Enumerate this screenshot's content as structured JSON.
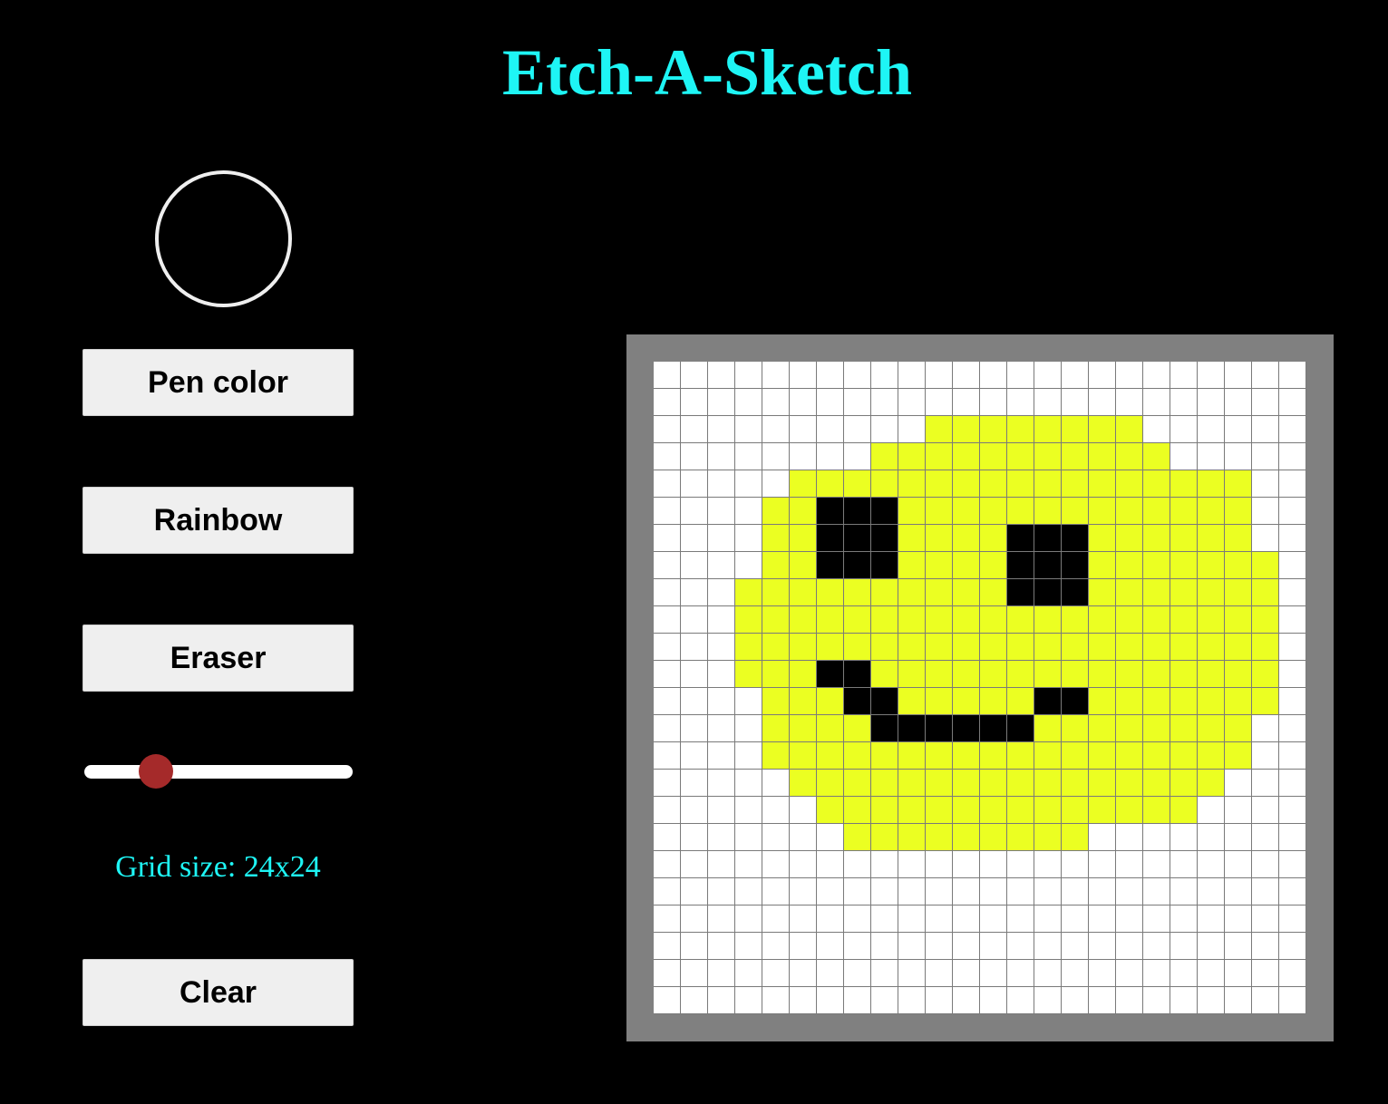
{
  "app": {
    "title": "Etch-A-Sketch"
  },
  "controls": {
    "pen_color_label": "Pen color",
    "rainbow_label": "Rainbow",
    "eraser_label": "Eraser",
    "clear_label": "Clear",
    "current_color": "#000000",
    "slider": {
      "value": 24,
      "min": 8,
      "max": 72
    },
    "grid_size_text": "Grid size: 24x24"
  },
  "board": {
    "size": 24,
    "palette": {
      ".": "#ffffff",
      "Y": "#ebff22",
      "B": "#000000"
    },
    "rows": [
      "........................",
      "........................",
      "..........YYYYYYYY......",
      "........YYYYYYYYYYY.....",
      ".....YYYYYYYYYYYYYYYYY..",
      "....YYBBBYYYYYYYYYYYYY..",
      "....YYBBBYYYYBBBYYYYYY..",
      "....YYBBBYYYYBBBYYYYYYY.",
      "...YYYYYYYYYYBBBYYYYYYY.",
      "...YYYYYYYYYYYYYYYYYYYY.",
      "...YYYYYYYYYYYYYYYYYYYY.",
      "...YYYBBYYYYYYYYYYYYYYY.",
      "....YYYBBYYYYYBBYYYYYYY.",
      "....YYYYBBBBBBYYYYYYYY..",
      "....YYYYYYYYYYYYYYYYYY..",
      ".....YYYYYYYYYYYYYYYY...",
      "......YYYYYYYYYYYYYY....",
      ".......YYYYYYYYY........",
      "........................",
      "........................",
      "........................",
      "........................",
      "........................",
      "........................"
    ]
  }
}
